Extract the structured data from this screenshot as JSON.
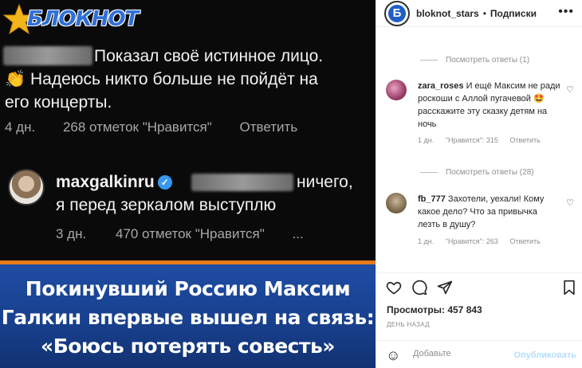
{
  "image": {
    "logo_text": "БЛОКНОТ",
    "comment1": {
      "line1": "Показал своё истинное лицо.",
      "line2": "Надеюсь никто больше не пойдёт на",
      "line3": "его концерты.",
      "emoji": "👏",
      "time": "4 дн.",
      "likes": "268 отметок \"Нравится\"",
      "reply": "Ответить"
    },
    "comment2": {
      "user": "maxgalkinru",
      "text_end": "ничего,",
      "line2": "я перед зеркалом выступлю",
      "time": "3 дн.",
      "likes": "470 отметок \"Нравится\"",
      "more": "..."
    },
    "headline": {
      "line1": "Покинувший Россию Максим",
      "line2": "Галкин впервые вышел на связь:",
      "line3": "«Боюсь потерять совесть»"
    }
  },
  "panel": {
    "header": {
      "username": "bloknot_stars",
      "dot": "•",
      "follow": "Подписки",
      "avatar_letter": "Б"
    },
    "view_replies_1": "Посмотреть ответы (1)",
    "comment_a": {
      "user": "zara_roses",
      "text": "И ещё Максим не ради роскоши с Аллой пугачевой 🤩 расскажите эту сказку детям на ночь",
      "time": "1 дн.",
      "likes": "\"Нравится\": 315",
      "reply": "Ответить"
    },
    "view_replies_2": "Посмотреть ответы (28)",
    "comment_b": {
      "user": "fb_777",
      "text": "Захотели, уехали! Кому какое дело? Что за привычка лезть в душу?",
      "time": "1 дн.",
      "likes": "\"Нравится\": 263",
      "reply": "Ответить"
    },
    "views": "Просмотры: 457 843",
    "date": "ДЕНЬ НАЗАД",
    "add_placeholder": "Добавьте",
    "publish": "Опубликовать"
  }
}
